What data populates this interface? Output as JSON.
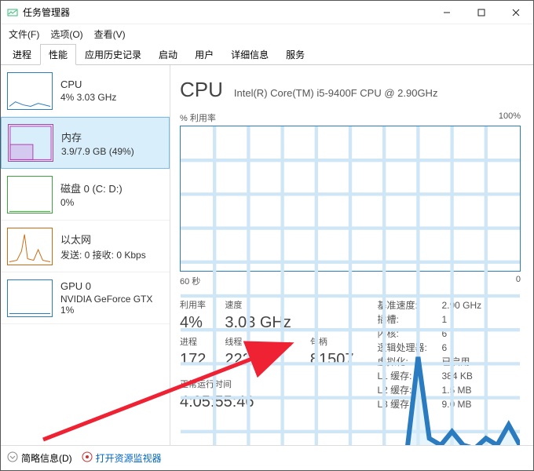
{
  "window": {
    "title": "任务管理器"
  },
  "menu": {
    "file": "文件(F)",
    "options": "选项(O)",
    "view": "查看(V)"
  },
  "tabs": [
    "进程",
    "性能",
    "应用历史记录",
    "启动",
    "用户",
    "详细信息",
    "服务"
  ],
  "active_tab": 1,
  "sidebar": [
    {
      "name": "CPU",
      "sub": "4% 3.03 GHz",
      "thumb_color": "#2a7bbf",
      "selected": false
    },
    {
      "name": "内存",
      "sub": "3.9/7.9 GB (49%)",
      "thumb_color": "#b03db0",
      "selected": true
    },
    {
      "name": "磁盘 0 (C: D:)",
      "sub": "0%",
      "thumb_color": "#3aa33a",
      "selected": false
    },
    {
      "name": "以太网",
      "sub": "发送: 0 接收: 0 Kbps",
      "thumb_color": "#c96b12",
      "selected": false
    },
    {
      "name": "GPU 0",
      "sub": "NVIDIA GeForce GTX\n1%",
      "thumb_color": "#2a7bbf",
      "selected": false
    }
  ],
  "main": {
    "title": "CPU",
    "subtitle": "Intel(R) Core(TM) i5-9400F CPU @ 2.90GHz",
    "chart_top_left": "% 利用率",
    "chart_top_right": "100%",
    "chart_btm_left": "60 秒",
    "chart_btm_right": "0",
    "stats_left": {
      "util_lbl": "利用率",
      "util": "4%",
      "speed_lbl": "速度",
      "speed": "3.03 GHz",
      "proc_lbl": "进程",
      "proc": "172",
      "thread_lbl": "线程",
      "thread": "2226",
      "handle_lbl": "句柄",
      "handle": "81507",
      "uptime_lbl": "正常运行时间",
      "uptime": "4:05:55:46"
    },
    "stats_right": [
      {
        "k": "基准速度:",
        "v": "2.90 GHz"
      },
      {
        "k": "插槽:",
        "v": "1"
      },
      {
        "k": "内核:",
        "v": "6"
      },
      {
        "k": "逻辑处理器:",
        "v": "6"
      },
      {
        "k": "虚拟化:",
        "v": "已启用"
      },
      {
        "k": "L1 缓存:",
        "v": "384 KB"
      },
      {
        "k": "L2 缓存:",
        "v": "1.5 MB"
      },
      {
        "k": "L3 缓存:",
        "v": "9.0 MB"
      }
    ]
  },
  "footer": {
    "brief": "简略信息(D)",
    "monitor": "打开资源监视器"
  },
  "chart_data": {
    "type": "line",
    "title": "% 利用率",
    "xlabel": "60 秒",
    "ylabel": "",
    "xlim": [
      60,
      0
    ],
    "ylim": [
      0,
      100
    ],
    "x": [
      60,
      55,
      50,
      45,
      40,
      35,
      30,
      28,
      26,
      24,
      22,
      20,
      18,
      16,
      14,
      12,
      10,
      8,
      6,
      4,
      2,
      0
    ],
    "values": [
      4,
      4,
      4,
      4,
      4,
      4,
      4,
      5,
      4,
      4,
      5,
      4,
      32,
      8,
      6,
      10,
      6,
      5,
      8,
      6,
      12,
      6
    ]
  }
}
